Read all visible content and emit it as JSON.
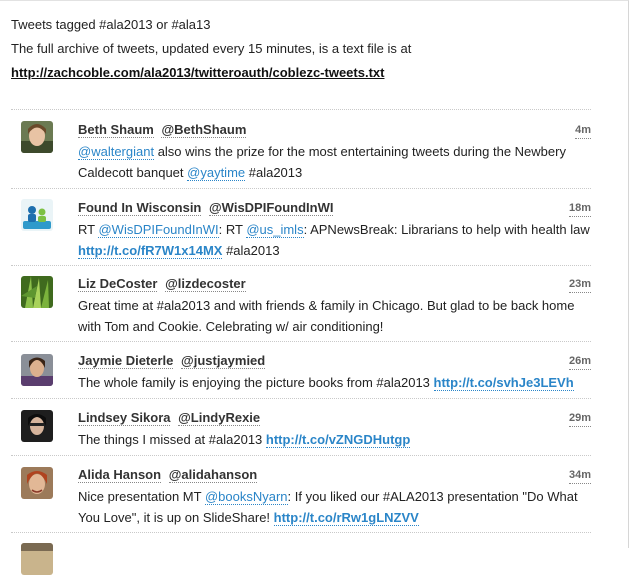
{
  "header": {
    "title": "Tweets tagged #ala2013 or #ala13",
    "description": "The full archive of tweets, updated every 15 minutes, is a text file is at",
    "archive_url": "http://zachcoble.com/ala2013/twitteroauth/coblezc-tweets.txt"
  },
  "tweets": [
    {
      "name": "Beth Shaum",
      "handle": "@BethShaum",
      "time": "4m",
      "seg": [
        {
          "t": "mention",
          "v": "@waltergiant"
        },
        {
          "t": "text",
          "v": " also wins the prize for the most entertaining tweets during the Newbery Caldecott banquet "
        },
        {
          "t": "mention",
          "v": "@yaytime"
        },
        {
          "t": "text",
          "v": " #ala2013"
        }
      ]
    },
    {
      "name": "Found In Wisconsin",
      "handle": "@WisDPIFoundInWI",
      "time": "18m",
      "seg": [
        {
          "t": "text",
          "v": "RT "
        },
        {
          "t": "mention",
          "v": "@WisDPIFoundInWI"
        },
        {
          "t": "text",
          "v": ": RT "
        },
        {
          "t": "mention",
          "v": "@us_imls"
        },
        {
          "t": "text",
          "v": ": APNewsBreak: Librarians to help with health law "
        },
        {
          "t": "link",
          "v": "http://t.co/fR7W1x14MX"
        },
        {
          "t": "text",
          "v": " #ala2013"
        }
      ]
    },
    {
      "name": "Liz DeCoster",
      "handle": "@lizdecoster",
      "time": "23m",
      "seg": [
        {
          "t": "text",
          "v": "Great time at #ala2013 and with friends & family in Chicago. But glad to be back home with Tom and Cookie. Celebrating w/ air conditioning!"
        }
      ]
    },
    {
      "name": "Jaymie Dieterle",
      "handle": "@justjaymied",
      "time": "26m",
      "seg": [
        {
          "t": "text",
          "v": "The whole family is enjoying the picture books from #ala2013 "
        },
        {
          "t": "link",
          "v": "http://t.co/svhJe3LEVh"
        }
      ]
    },
    {
      "name": "Lindsey Sikora",
      "handle": "@LindyRexie",
      "time": "29m",
      "seg": [
        {
          "t": "text",
          "v": "The things I missed at #ala2013 "
        },
        {
          "t": "link",
          "v": "http://t.co/vZNGDHutgp"
        }
      ]
    },
    {
      "name": "Alida Hanson",
      "handle": "@alidahanson",
      "time": "34m",
      "seg": [
        {
          "t": "text",
          "v": "Nice presentation MT "
        },
        {
          "t": "mention",
          "v": "@booksNyarn"
        },
        {
          "t": "text",
          "v": ": If you liked our #ALA2013 presentation \"Do What You Love\", it is up on SlideShare! "
        },
        {
          "t": "link",
          "v": "http://t.co/rRw1gLNZVV"
        }
      ]
    }
  ]
}
